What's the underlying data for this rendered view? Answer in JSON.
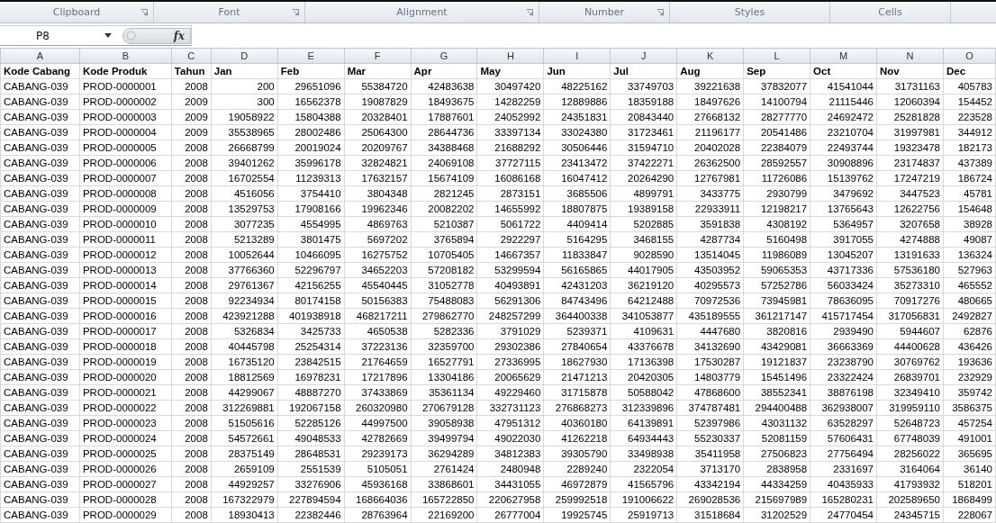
{
  "ribbon_groups": [
    {
      "label": "Clipboard",
      "launcher": true
    },
    {
      "label": "Font",
      "launcher": true
    },
    {
      "label": "Alignment",
      "launcher": true
    },
    {
      "label": "Number",
      "launcher": true
    },
    {
      "label": "Styles",
      "launcher": false
    },
    {
      "label": "Cells",
      "launcher": false
    }
  ],
  "formula_bar": {
    "name_box": "P8",
    "function_button": "fx"
  },
  "sheet": {
    "column_letters": [
      "A",
      "B",
      "C",
      "D",
      "E",
      "F",
      "G",
      "H",
      "I",
      "J",
      "K",
      "L",
      "M",
      "N",
      "O"
    ],
    "header": [
      "Kode Cabang",
      "Kode Produk",
      "Tahun",
      "Jan",
      "Feb",
      "Mar",
      "Apr",
      "May",
      "Jun",
      "Jul",
      "Aug",
      "Sep",
      "Oct",
      "Nov",
      "Dec"
    ],
    "rows": [
      [
        "CABANG-039",
        "PROD-0000001",
        "2008",
        "200",
        "29651096",
        "55384720",
        "42483638",
        "30497420",
        "48225162",
        "33749703",
        "39221638",
        "37832077",
        "41541044",
        "31731163",
        "405783"
      ],
      [
        "CABANG-039",
        "PROD-0000002",
        "2009",
        "300",
        "16562378",
        "19087829",
        "18493675",
        "14282259",
        "12889886",
        "18359188",
        "18497626",
        "14100794",
        "21115446",
        "12060394",
        "154452"
      ],
      [
        "CABANG-039",
        "PROD-0000003",
        "2009",
        "19058922",
        "15804388",
        "20328401",
        "17887601",
        "24052992",
        "24351831",
        "20843440",
        "27668132",
        "28277770",
        "24692472",
        "25281828",
        "223528"
      ],
      [
        "CABANG-039",
        "PROD-0000004",
        "2009",
        "35538965",
        "28002486",
        "25064300",
        "28644736",
        "33397134",
        "33024380",
        "31723461",
        "21196177",
        "20541486",
        "23210704",
        "31997981",
        "344912"
      ],
      [
        "CABANG-039",
        "PROD-0000005",
        "2008",
        "26668799",
        "20019024",
        "20209767",
        "34388468",
        "21688292",
        "30506446",
        "31594710",
        "20402028",
        "22384079",
        "22493744",
        "19323478",
        "182173"
      ],
      [
        "CABANG-039",
        "PROD-0000006",
        "2008",
        "39401262",
        "35996178",
        "32824821",
        "24069108",
        "37727115",
        "23413472",
        "37422271",
        "26362500",
        "28592557",
        "30908896",
        "23174837",
        "437389"
      ],
      [
        "CABANG-039",
        "PROD-0000007",
        "2008",
        "16702554",
        "11239313",
        "17632157",
        "15674109",
        "16086168",
        "16047412",
        "20264290",
        "12767981",
        "11726086",
        "15139762",
        "17247219",
        "186724"
      ],
      [
        "CABANG-039",
        "PROD-0000008",
        "2008",
        "4516056",
        "3754410",
        "3804348",
        "2821245",
        "2873151",
        "3685506",
        "4899791",
        "3433775",
        "2930799",
        "3479692",
        "3447523",
        "45781"
      ],
      [
        "CABANG-039",
        "PROD-0000009",
        "2008",
        "13529753",
        "17908166",
        "19962346",
        "20082202",
        "14655992",
        "18807875",
        "19389158",
        "22933911",
        "12198217",
        "13765643",
        "12622756",
        "154648"
      ],
      [
        "CABANG-039",
        "PROD-0000010",
        "2008",
        "3077235",
        "4554995",
        "4869763",
        "5210387",
        "5061722",
        "4409414",
        "5202885",
        "3591838",
        "4308192",
        "5364957",
        "3207658",
        "38928"
      ],
      [
        "CABANG-039",
        "PROD-0000011",
        "2008",
        "5213289",
        "3801475",
        "5697202",
        "3765894",
        "2922297",
        "5164295",
        "3468155",
        "4287734",
        "5160498",
        "3917055",
        "4274888",
        "49087"
      ],
      [
        "CABANG-039",
        "PROD-0000012",
        "2008",
        "10052644",
        "10466095",
        "16275752",
        "10705405",
        "14667357",
        "11833847",
        "9028590",
        "13514045",
        "11986089",
        "13045207",
        "13191633",
        "136324"
      ],
      [
        "CABANG-039",
        "PROD-0000013",
        "2008",
        "37766360",
        "52296797",
        "34652203",
        "57208182",
        "53299594",
        "56165865",
        "44017905",
        "43503952",
        "59065353",
        "43717336",
        "57536180",
        "527963"
      ],
      [
        "CABANG-039",
        "PROD-0000014",
        "2008",
        "29761367",
        "42156255",
        "45540445",
        "31052778",
        "40493891",
        "42431203",
        "36219120",
        "40295573",
        "57252786",
        "56033424",
        "35273310",
        "465552"
      ],
      [
        "CABANG-039",
        "PROD-0000015",
        "2008",
        "92234934",
        "80174158",
        "50156383",
        "75488083",
        "56291306",
        "84743496",
        "64212488",
        "70972536",
        "73945981",
        "78636095",
        "70917276",
        "480665"
      ],
      [
        "CABANG-039",
        "PROD-0000016",
        "2008",
        "423921288",
        "401938918",
        "468217211",
        "279862770",
        "248257299",
        "364400338",
        "341053877",
        "435189555",
        "361217147",
        "415717454",
        "317056831",
        "2492827"
      ],
      [
        "CABANG-039",
        "PROD-0000017",
        "2008",
        "5326834",
        "3425733",
        "4650538",
        "5282336",
        "3791029",
        "5239371",
        "4109631",
        "4447680",
        "3820816",
        "2939490",
        "5944607",
        "62876"
      ],
      [
        "CABANG-039",
        "PROD-0000018",
        "2008",
        "40445798",
        "25254314",
        "37223136",
        "32359700",
        "29302386",
        "27840654",
        "43376678",
        "34132690",
        "43429081",
        "36663369",
        "44400628",
        "436426"
      ],
      [
        "CABANG-039",
        "PROD-0000019",
        "2008",
        "16735120",
        "23842515",
        "21764659",
        "16527791",
        "27336995",
        "18627930",
        "17136398",
        "17530287",
        "19121837",
        "23238790",
        "30769762",
        "193636"
      ],
      [
        "CABANG-039",
        "PROD-0000020",
        "2008",
        "18812569",
        "16978231",
        "17217896",
        "13304186",
        "20065629",
        "21471213",
        "20420305",
        "14803779",
        "15451496",
        "23322424",
        "26839701",
        "232929"
      ],
      [
        "CABANG-039",
        "PROD-0000021",
        "2008",
        "44299067",
        "48887270",
        "37433869",
        "35361134",
        "49229460",
        "31715878",
        "50588042",
        "47868600",
        "38552341",
        "38876198",
        "32349410",
        "359742"
      ],
      [
        "CABANG-039",
        "PROD-0000022",
        "2008",
        "312269881",
        "192067158",
        "260320980",
        "270679128",
        "332731123",
        "276868273",
        "312339896",
        "374787481",
        "294400488",
        "362938007",
        "319959110",
        "3586375"
      ],
      [
        "CABANG-039",
        "PROD-0000023",
        "2008",
        "51505616",
        "52285126",
        "44997500",
        "39058938",
        "47951312",
        "40360180",
        "64139891",
        "52397986",
        "43031132",
        "63528297",
        "52648723",
        "457254"
      ],
      [
        "CABANG-039",
        "PROD-0000024",
        "2008",
        "54572661",
        "49048533",
        "42782669",
        "39499794",
        "49022030",
        "41262218",
        "64934443",
        "55230337",
        "52081159",
        "57606431",
        "67748039",
        "491001"
      ],
      [
        "CABANG-039",
        "PROD-0000025",
        "2008",
        "28375149",
        "28648531",
        "29239173",
        "36294289",
        "34812383",
        "39305790",
        "33498938",
        "35411958",
        "27506823",
        "27756494",
        "28256022",
        "365695"
      ],
      [
        "CABANG-039",
        "PROD-0000026",
        "2008",
        "2659109",
        "2551539",
        "5105051",
        "2761424",
        "2480948",
        "2289240",
        "2322054",
        "3713170",
        "2838958",
        "2331697",
        "3164064",
        "36140"
      ],
      [
        "CABANG-039",
        "PROD-0000027",
        "2008",
        "44929257",
        "33276906",
        "45936168",
        "33868601",
        "34431055",
        "46972879",
        "41565796",
        "43342194",
        "44334259",
        "40435933",
        "41793932",
        "518201"
      ],
      [
        "CABANG-039",
        "PROD-0000028",
        "2008",
        "167322979",
        "227894594",
        "168664036",
        "165722850",
        "220627958",
        "259992518",
        "191006622",
        "269028536",
        "215697989",
        "165280231",
        "202589650",
        "1868499"
      ],
      [
        "CABANG-039",
        "PROD-0000029",
        "2008",
        "18930413",
        "22382446",
        "28763964",
        "22169200",
        "26777004",
        "19925745",
        "25919713",
        "31518684",
        "31202529",
        "24770454",
        "24345715",
        "228067"
      ]
    ]
  }
}
